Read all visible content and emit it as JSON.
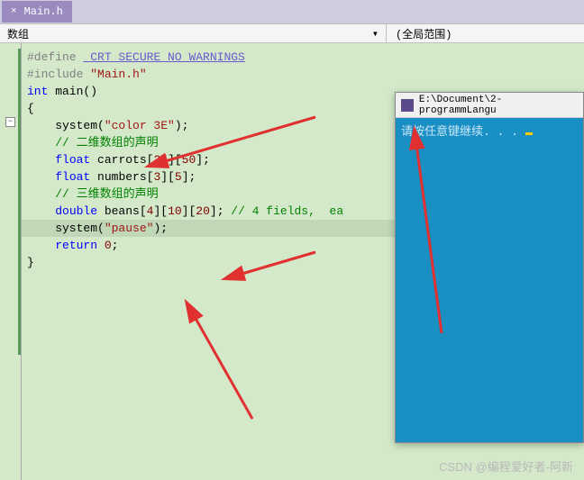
{
  "tab": {
    "label": "Main.h",
    "close": "×"
  },
  "toolbar": {
    "left_label": "数组",
    "dropdown_icon": "▾",
    "scope_label": "(全局范围)"
  },
  "fold": {
    "collapse": "−"
  },
  "code": {
    "l1_pp": "#define ",
    "l1_name": "_CRT_SECURE_NO_WARNINGS",
    "l2": "",
    "l3_pp": "#include ",
    "l3_str": "\"Main.h\"",
    "l4": "",
    "l5_type": "int",
    "l5_rest": " main()",
    "l6": "{",
    "l7_pre": "    system(",
    "l7_str": "\"color 3E\"",
    "l7_post": ");",
    "l8": "",
    "l9_pre": "    ",
    "l9_com": "// 二维数组的声明",
    "l10_pre": "    ",
    "l10_type": "float",
    "l10_a": " carrots[",
    "l10_n1": "25",
    "l10_b": "][",
    "l10_n2": "50",
    "l10_c": "];",
    "l11_pre": "    ",
    "l11_type": "float",
    "l11_a": " numbers[",
    "l11_n1": "3",
    "l11_b": "][",
    "l11_n2": "5",
    "l11_c": "];",
    "l12": "",
    "l13_pre": "    ",
    "l13_com": "// 三维数组的声明",
    "l14_pre": "    ",
    "l14_type": "double",
    "l14_a": " beans[",
    "l14_n1": "4",
    "l14_b": "][",
    "l14_n2": "10",
    "l14_c": "][",
    "l14_n3": "20",
    "l14_d": "]; ",
    "l14_com": "// 4 fields,  ea",
    "l15": "",
    "l16_pre": "    system(",
    "l16_str": "\"pause\"",
    "l16_post": ");",
    "l17_pre": "    ",
    "l17_type": "return",
    "l17_a": " ",
    "l17_n": "0",
    "l17_b": ";",
    "l18": "}"
  },
  "console": {
    "title": "E:\\Document\\2-programmLangu",
    "text": "请按任意键继续. . . "
  },
  "watermark": "CSDN @编程爱好者-阿新"
}
